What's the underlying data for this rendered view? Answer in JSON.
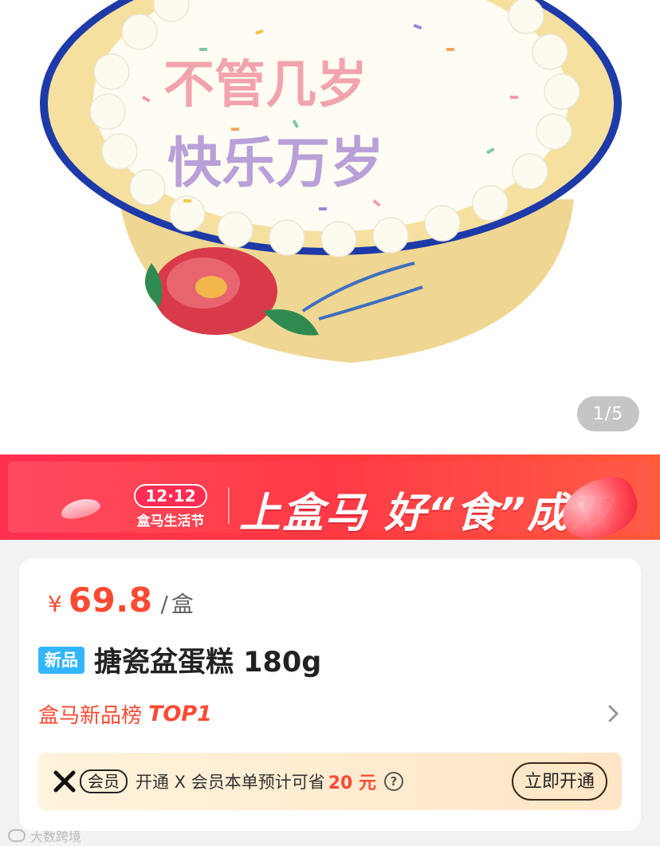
{
  "hero": {
    "cake_text_line1": "不管几岁",
    "cake_text_line2": "快乐万岁",
    "image_counter": "1/5"
  },
  "banner": {
    "badge_number": "12·12",
    "badge_subtitle": "盒马生活节",
    "slogan": "上盒马 好“食”成双"
  },
  "product": {
    "currency": "¥",
    "price": "69.8",
    "unit_separator": "/",
    "unit": "盒",
    "new_tag": "新品",
    "title": "搪瓷盆蛋糕 180g",
    "rank_label": "盒马新品榜",
    "rank_value": "TOP1"
  },
  "member": {
    "chip_label": "会员",
    "text": "开通 X 会员本单预计可省",
    "save_amount": "20 元",
    "help_icon": "?",
    "button_label": "立即开通"
  },
  "watermark": {
    "text": "大数跨境"
  },
  "colors": {
    "accent_red": "#ff4a33",
    "banner_red": "#ff3a45",
    "new_tag_blue": "#33b6ff",
    "member_bg": "#ffe6c6"
  },
  "icons": {
    "rank_arrow": "chevron-right-icon",
    "x_member": "x-member-logo-icon",
    "help": "question-circle-icon"
  }
}
